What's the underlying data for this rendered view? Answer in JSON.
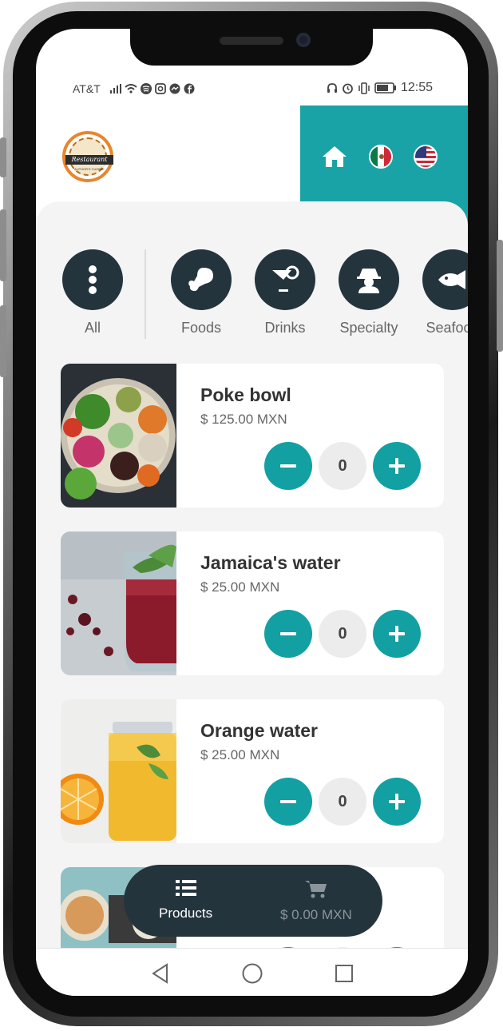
{
  "status_bar": {
    "carrier": "AT&T",
    "time": "12:55"
  },
  "header": {
    "logo_text": "Restaurant",
    "logo_subtext": "AUTHOR'S CUISINE",
    "flags": [
      "mexico-flag",
      "usa-flag"
    ]
  },
  "categories": [
    {
      "label": "All",
      "icon": "more-vertical-icon"
    },
    {
      "label": "Foods",
      "icon": "drumstick-icon"
    },
    {
      "label": "Drinks",
      "icon": "cocktail-icon"
    },
    {
      "label": "Specialty",
      "icon": "chef-icon"
    },
    {
      "label": "Seafood",
      "icon": "fish-icon"
    }
  ],
  "products": [
    {
      "name": "Poke bowl",
      "price": "$ 125.00 MXN",
      "quantity": "0"
    },
    {
      "name": "Jamaica's water",
      "price": "$ 25.00 MXN",
      "quantity": "0"
    },
    {
      "name": "Orange water",
      "price": "$ 25.00 MXN",
      "quantity": "0"
    }
  ],
  "bottom_bar": {
    "products_label": "Products",
    "cart_label": "$ 0.00 MXN"
  },
  "colors": {
    "accent": "#1aa3a6",
    "dark": "#24343d",
    "background": "#f4f4f4"
  }
}
